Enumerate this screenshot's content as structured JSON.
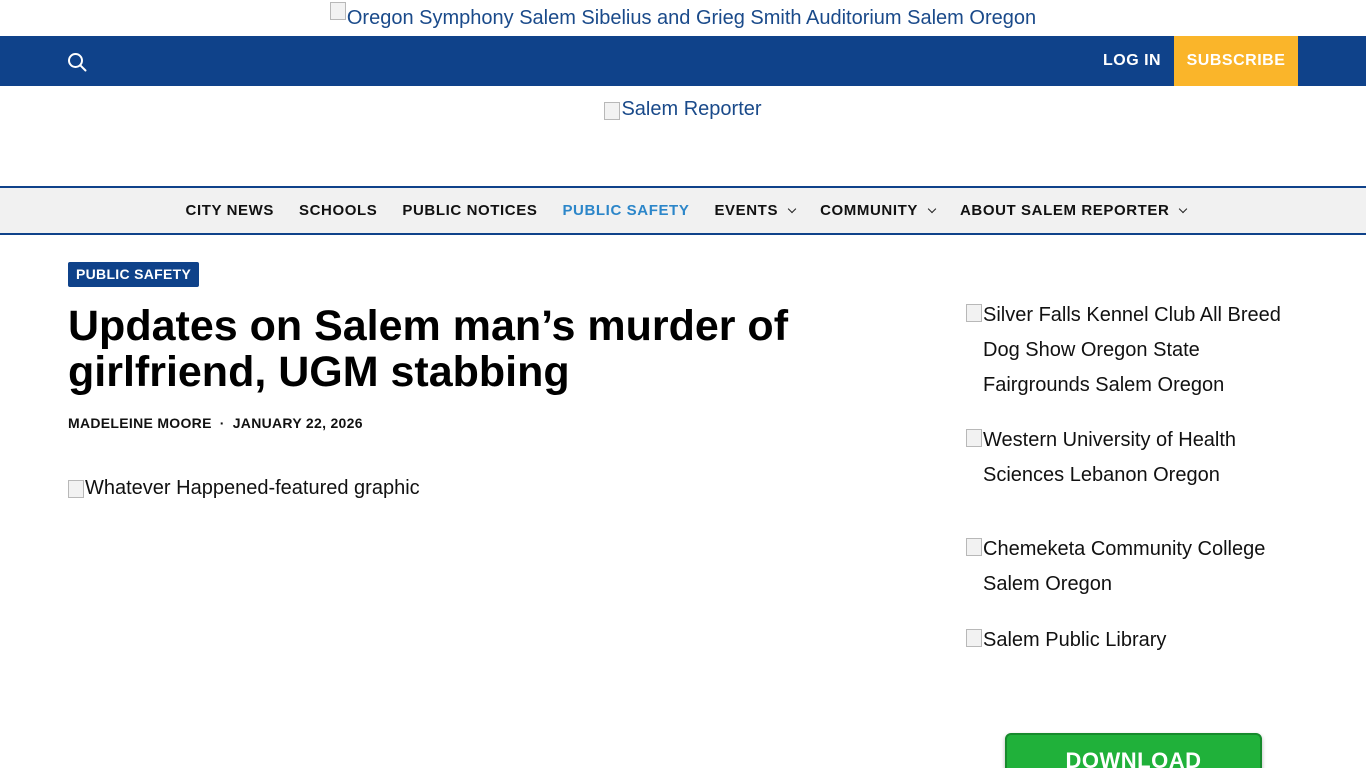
{
  "top_ad": {
    "alt": "Oregon Symphony Salem Sibelius and Grieg Smith Auditorium Salem Oregon"
  },
  "header": {
    "search_icon": "search-icon",
    "login_label": "LOG IN",
    "subscribe_label": "SUBSCRIBE",
    "logo_alt": "Salem Reporter"
  },
  "nav": {
    "items": [
      {
        "label": "CITY NEWS"
      },
      {
        "label": "SCHOOLS"
      },
      {
        "label": "PUBLIC NOTICES"
      },
      {
        "label": "PUBLIC SAFETY"
      },
      {
        "label": "EVENTS"
      },
      {
        "label": "COMMUNITY"
      },
      {
        "label": "ABOUT SALEM REPORTER"
      }
    ]
  },
  "article": {
    "category": "PUBLIC SAFETY",
    "title": "Updates on Salem man’s murder of girlfriend, UGM stabbing",
    "author": "MADELEINE MOORE",
    "separator": "·",
    "date": "JANUARY 22, 2026",
    "featured_alt": "Whatever Happened-featured graphic"
  },
  "sidebar": {
    "ads": [
      {
        "alt": "Silver Falls Kennel Club All Breed Dog Show Oregon State Fairgrounds Salem Oregon"
      },
      {
        "alt": "Western University of Health Sciences Lebanon Oregon"
      },
      {
        "alt": "Chemeketa Community College Salem Oregon"
      },
      {
        "alt": "Salem Public Library"
      }
    ],
    "download_label": "DOWNLOAD"
  },
  "colors": {
    "brand_blue": "#0f428a",
    "subscribe_yellow": "#fab52a",
    "active_nav": "#2c86c9",
    "download_green": "#20b13a"
  }
}
